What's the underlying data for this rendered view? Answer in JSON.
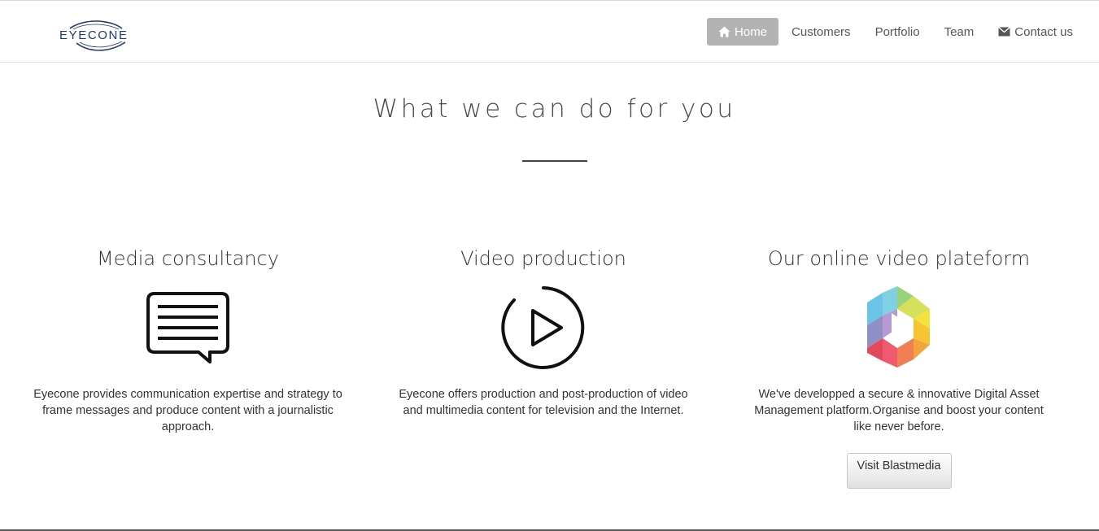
{
  "brand": {
    "name": "EYECONE"
  },
  "nav": {
    "items": [
      {
        "label": "Home",
        "icon": "home-icon",
        "active": true
      },
      {
        "label": "Customers"
      },
      {
        "label": "Portfolio"
      },
      {
        "label": "Team"
      },
      {
        "label": "Contact us",
        "icon": "envelope-icon"
      }
    ]
  },
  "hero": {
    "title": "What we can do for you"
  },
  "services": [
    {
      "title": "Media consultancy",
      "icon": "speech-bubble-icon",
      "text": "Eyecone provides communication expertise and strategy to frame messages and produce content with a journalistic approach."
    },
    {
      "title": "Video production",
      "icon": "play-circle-icon",
      "text": "Eyecone offers production and post-production of video and multimedia content for television and the Internet."
    },
    {
      "title": "Our online video plateform",
      "icon": "blastmedia-logo-icon",
      "text": "We've developped a secure & innovative Digital Asset Management platform.Organise and boost your content like never before.",
      "button": "Visit Blastmedia"
    }
  ],
  "colors": {
    "nav_active": "#b3b3b3",
    "brand": "#1f3a6b"
  }
}
